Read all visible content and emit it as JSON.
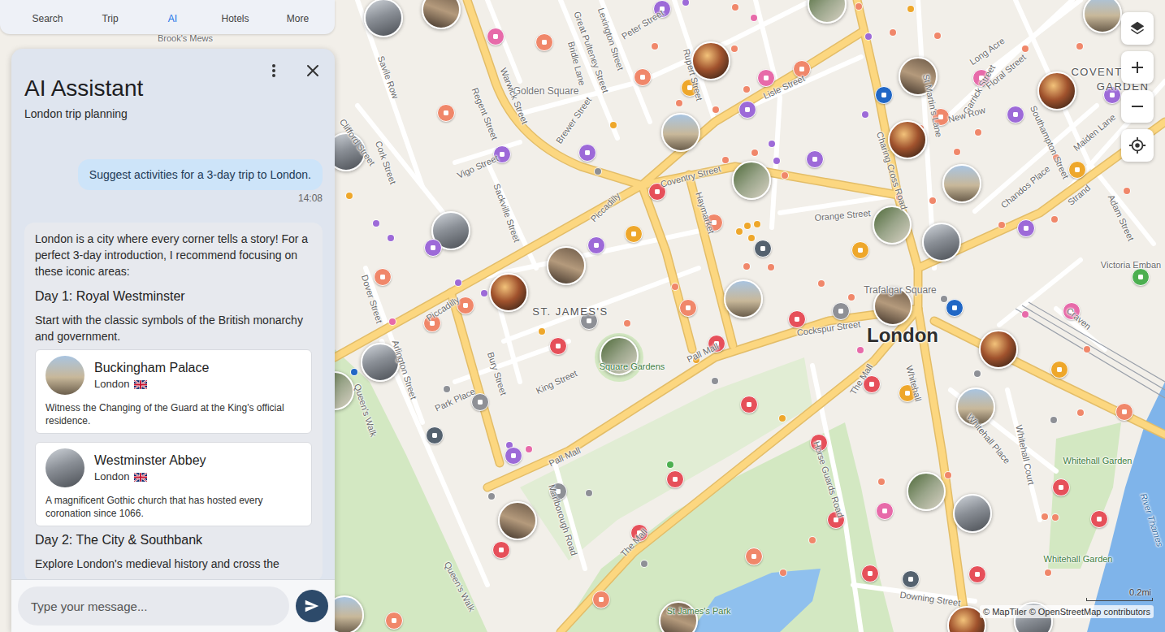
{
  "navigation": {
    "tabs": [
      {
        "label": "Search",
        "selected": false
      },
      {
        "label": "Trip",
        "selected": false
      },
      {
        "label": "AI",
        "selected": true
      },
      {
        "label": "Hotels",
        "selected": false
      },
      {
        "label": "More",
        "selected": false
      }
    ]
  },
  "assistant": {
    "title": "AI Assistant",
    "subtitle": "London trip planning",
    "user_message": {
      "text": "Suggest activities for a 3-day trip to London.",
      "time": "14:08"
    },
    "reply": {
      "intro": "London is a city where every corner tells a story! For a perfect 3-day introduction, I recommend focusing on these iconic areas:",
      "sections": [
        {
          "heading": "Day 1: Royal Westminster",
          "text": "Start with the classic symbols of the British monarchy and government.",
          "places": [
            {
              "name": "Buckingham Palace",
              "city": "London",
              "description": "Witness the Changing of the Guard at the King's official residence."
            },
            {
              "name": "Westminster Abbey",
              "city": "London",
              "description": "A magnificent Gothic church that has hosted every coronation since 1066."
            }
          ]
        },
        {
          "heading": "Day 2: The City & Southbank",
          "text": "Explore London's medieval history and cross the",
          "places": []
        }
      ]
    },
    "input": {
      "placeholder": "Type your message..."
    }
  },
  "map": {
    "labels": [
      {
        "text": "Savile Row",
        "kind": "street"
      },
      {
        "text": "Golden Square",
        "kind": "area"
      },
      {
        "text": "Regent Street",
        "kind": "street"
      },
      {
        "text": "Warwick Street",
        "kind": "street"
      },
      {
        "text": "Brewer Street",
        "kind": "street"
      },
      {
        "text": "Great Pulteney Street",
        "kind": "street"
      },
      {
        "text": "Bridle Lane",
        "kind": "street"
      },
      {
        "text": "Lexington Street",
        "kind": "street"
      },
      {
        "text": "Peter Street",
        "kind": "street"
      },
      {
        "text": "Rupert Street",
        "kind": "street"
      },
      {
        "text": "Lisle Street",
        "kind": "street"
      },
      {
        "text": "Vigo Street",
        "kind": "street"
      },
      {
        "text": "Sackville Street",
        "kind": "street"
      },
      {
        "text": "Cork Street",
        "kind": "street"
      },
      {
        "text": "Clifford Street",
        "kind": "street"
      },
      {
        "text": "Piccadilly",
        "kind": "street"
      },
      {
        "text": "Piccadilly",
        "kind": "street"
      },
      {
        "text": "Coventry Street",
        "kind": "street"
      },
      {
        "text": "Haymarket",
        "kind": "street"
      },
      {
        "text": "Orange Street",
        "kind": "street"
      },
      {
        "text": "Charing Cross Road",
        "kind": "street"
      },
      {
        "text": "St Martin's Lane",
        "kind": "street"
      },
      {
        "text": "Long Acre",
        "kind": "street"
      },
      {
        "text": "Garrick Street",
        "kind": "street"
      },
      {
        "text": "Floral Street",
        "kind": "street"
      },
      {
        "text": "New Row",
        "kind": "street"
      },
      {
        "text": "Southampton Street",
        "kind": "street"
      },
      {
        "text": "Maiden Lane",
        "kind": "street"
      },
      {
        "text": "Chandos Place",
        "kind": "street"
      },
      {
        "text": "Strand",
        "kind": "street"
      },
      {
        "text": "Adam Street",
        "kind": "street"
      },
      {
        "text": "Trafalgar Square",
        "kind": "area"
      },
      {
        "text": "London",
        "kind": "city"
      },
      {
        "text": "Cockspur Street",
        "kind": "street"
      },
      {
        "text": "Craven",
        "kind": "street"
      },
      {
        "text": "Victoria Emban",
        "kind": "street"
      },
      {
        "text": "Whitehall",
        "kind": "street"
      },
      {
        "text": "Whitehall Place",
        "kind": "street"
      },
      {
        "text": "Whitehall Court",
        "kind": "street"
      },
      {
        "text": "Whitehall Garden",
        "kind": "park"
      },
      {
        "text": "Whitehall Garden",
        "kind": "park"
      },
      {
        "text": "River Thames",
        "kind": "water"
      },
      {
        "text": "Horse Guards Road",
        "kind": "street"
      },
      {
        "text": "The Mall",
        "kind": "street"
      },
      {
        "text": "The Mall",
        "kind": "street"
      },
      {
        "text": "Pall Mall",
        "kind": "street"
      },
      {
        "text": "Pall Mall",
        "kind": "street"
      },
      {
        "text": "ST. JAMES'S",
        "kind": "district"
      },
      {
        "text": "King Street",
        "kind": "street"
      },
      {
        "text": "Bury Street",
        "kind": "street"
      },
      {
        "text": "Park Place",
        "kind": "street"
      },
      {
        "text": "Arlington Street",
        "kind": "street"
      },
      {
        "text": "Dover Street",
        "kind": "street"
      },
      {
        "text": "Queen's Walk",
        "kind": "street"
      },
      {
        "text": "Queen's Walk",
        "kind": "street"
      },
      {
        "text": "Marlborough Road",
        "kind": "street"
      },
      {
        "text": "Downing Street",
        "kind": "street"
      },
      {
        "text": "St James's Park",
        "kind": "park"
      },
      {
        "text": "Square Gardens",
        "kind": "park"
      },
      {
        "text": "Brook's Mews",
        "kind": "street"
      },
      {
        "text": "COVENT",
        "kind": "district"
      },
      {
        "text": "GARDEN",
        "kind": "district"
      }
    ],
    "markers": [
      {
        "kind": "photo"
      },
      {
        "kind": "photo"
      },
      {
        "kind": "photo"
      },
      {
        "kind": "photo"
      },
      {
        "kind": "photo"
      },
      {
        "kind": "photo"
      },
      {
        "kind": "photo"
      },
      {
        "kind": "photo"
      },
      {
        "kind": "photo"
      },
      {
        "kind": "photo"
      },
      {
        "kind": "photo"
      },
      {
        "kind": "photo"
      },
      {
        "kind": "photo"
      },
      {
        "kind": "photo"
      },
      {
        "kind": "photo"
      },
      {
        "kind": "photo"
      },
      {
        "kind": "photo"
      },
      {
        "kind": "photo"
      },
      {
        "kind": "photo"
      },
      {
        "kind": "photo"
      },
      {
        "kind": "photo"
      },
      {
        "kind": "photo"
      },
      {
        "kind": "photo"
      },
      {
        "kind": "photo"
      },
      {
        "kind": "photo"
      },
      {
        "kind": "photo"
      },
      {
        "kind": "photo"
      },
      {
        "kind": "photo"
      },
      {
        "kind": "photo"
      },
      {
        "kind": "photo"
      },
      {
        "kind": "photo"
      },
      {
        "kind": "poi",
        "color": "#9d6ad8"
      },
      {
        "kind": "poi",
        "color": "#e76aa9"
      },
      {
        "kind": "poi",
        "color": "#f0876a"
      },
      {
        "kind": "poi",
        "color": "#f0876a"
      },
      {
        "kind": "poi",
        "color": "#eea72b"
      },
      {
        "kind": "poi",
        "color": "#e76aa9"
      },
      {
        "kind": "poi",
        "color": "#f0876a"
      },
      {
        "kind": "poi",
        "color": "#9d6ad8"
      },
      {
        "kind": "poi",
        "color": "#f0876a"
      },
      {
        "kind": "poi",
        "color": "#9d6ad8"
      },
      {
        "kind": "poi",
        "color": "#9d6ad8"
      },
      {
        "kind": "poi",
        "color": "#9d6ad8"
      },
      {
        "kind": "poi",
        "color": "#2167c5"
      },
      {
        "kind": "poi",
        "color": "#e76aa9"
      },
      {
        "kind": "poi",
        "color": "#f0876a"
      },
      {
        "kind": "poi",
        "color": "#9d6ad8"
      },
      {
        "kind": "poi",
        "color": "#9d6ad8"
      },
      {
        "kind": "poi",
        "color": "#eea72b"
      },
      {
        "kind": "poi",
        "color": "#e6505a"
      },
      {
        "kind": "poi",
        "color": "#f0876a"
      },
      {
        "kind": "poi",
        "color": "#eea72b"
      },
      {
        "kind": "poi",
        "color": "#55626f"
      },
      {
        "kind": "poi",
        "color": "#9d6ad8"
      },
      {
        "kind": "poi",
        "color": "#9d6ad8"
      },
      {
        "kind": "poi",
        "color": "#eea72b"
      },
      {
        "kind": "poi",
        "color": "#9d6ad8"
      },
      {
        "kind": "poi",
        "color": "#f0876a"
      },
      {
        "kind": "poi",
        "color": "#f0876a"
      },
      {
        "kind": "poi",
        "color": "#f0876a"
      },
      {
        "kind": "poi",
        "color": "#f0876a"
      },
      {
        "kind": "poi",
        "color": "#8e9096"
      },
      {
        "kind": "poi",
        "color": "#e6505a"
      },
      {
        "kind": "poi",
        "color": "#8e9096"
      },
      {
        "kind": "poi",
        "color": "#e6505a"
      },
      {
        "kind": "poi",
        "color": "#e6505a"
      },
      {
        "kind": "poi",
        "color": "#2167c5"
      },
      {
        "kind": "poi",
        "color": "#e76aa9"
      },
      {
        "kind": "poi",
        "color": "#4caf50"
      },
      {
        "kind": "poi",
        "color": "#8e9096"
      },
      {
        "kind": "poi",
        "color": "#55626f"
      },
      {
        "kind": "poi",
        "color": "#e6505a"
      },
      {
        "kind": "poi",
        "color": "#eea72b"
      },
      {
        "kind": "poi",
        "color": "#eea72b"
      },
      {
        "kind": "poi",
        "color": "#e6505a"
      },
      {
        "kind": "poi",
        "color": "#e6505a"
      },
      {
        "kind": "poi",
        "color": "#f0876a"
      },
      {
        "kind": "poi",
        "color": "#9d6ad8"
      },
      {
        "kind": "poi",
        "color": "#e6505a"
      },
      {
        "kind": "poi",
        "color": "#e76aa9"
      },
      {
        "kind": "poi",
        "color": "#e6505a"
      },
      {
        "kind": "poi",
        "color": "#e6505a"
      },
      {
        "kind": "poi",
        "color": "#e6505a"
      },
      {
        "kind": "poi",
        "color": "#8e9096"
      },
      {
        "kind": "poi",
        "color": "#e6505a"
      },
      {
        "kind": "poi",
        "color": "#e6505a"
      },
      {
        "kind": "poi",
        "color": "#f0876a"
      },
      {
        "kind": "poi",
        "color": "#e6505a"
      },
      {
        "kind": "poi",
        "color": "#55626f"
      },
      {
        "kind": "poi",
        "color": "#e6505a"
      },
      {
        "kind": "poi",
        "color": "#f0876a"
      },
      {
        "kind": "poi",
        "color": "#f0876a"
      }
    ],
    "dots": [
      {
        "color": "#f0876a"
      },
      {
        "color": "#e76aa9"
      },
      {
        "color": "#f0876a"
      },
      {
        "color": "#eea72b"
      },
      {
        "color": "#f0876a"
      },
      {
        "color": "#f0876a"
      },
      {
        "color": "#f0876a"
      },
      {
        "color": "#9d6ad8"
      },
      {
        "color": "#f0876a"
      },
      {
        "color": "#9d6ad8"
      },
      {
        "color": "#f0876a"
      },
      {
        "color": "#f0876a"
      },
      {
        "color": "#f0876a"
      },
      {
        "color": "#f0876a"
      },
      {
        "color": "#9d6ad8"
      },
      {
        "color": "#9d6ad8"
      },
      {
        "color": "#f0876a"
      },
      {
        "color": "#f0876a"
      },
      {
        "color": "#f0876a"
      },
      {
        "color": "#f0876a"
      },
      {
        "color": "#eea72b"
      },
      {
        "color": "#8e9096"
      },
      {
        "color": "#eea72b"
      },
      {
        "color": "#9d6ad8"
      },
      {
        "color": "#9d6ad8"
      },
      {
        "color": "#9d6ad8"
      },
      {
        "color": "#9d6ad8"
      },
      {
        "color": "#2167c5"
      },
      {
        "color": "#e76aa9"
      },
      {
        "color": "#8e9096"
      },
      {
        "color": "#eea72b"
      },
      {
        "color": "#f0876a"
      },
      {
        "color": "#f0876a"
      },
      {
        "color": "#eea72b"
      },
      {
        "color": "#8e9096"
      },
      {
        "color": "#f0876a"
      },
      {
        "color": "#f0876a"
      },
      {
        "color": "#eea72b"
      },
      {
        "color": "#eea72b"
      },
      {
        "color": "#eea72b"
      },
      {
        "color": "#eea72b"
      },
      {
        "color": "#f0876a"
      },
      {
        "color": "#f0876a"
      },
      {
        "color": "#e76aa9"
      },
      {
        "color": "#8e9096"
      },
      {
        "color": "#8e9096"
      },
      {
        "color": "#f0876a"
      },
      {
        "color": "#f0876a"
      },
      {
        "color": "#8e9096"
      },
      {
        "color": "#f0876a"
      },
      {
        "color": "#e76aa9"
      },
      {
        "color": "#f0876a"
      },
      {
        "color": "#f0876a"
      },
      {
        "color": "#f0876a"
      },
      {
        "color": "#f0876a"
      },
      {
        "color": "#f0876a"
      },
      {
        "color": "#f0876a"
      },
      {
        "color": "#f0876a"
      },
      {
        "color": "#eea72b"
      },
      {
        "color": "#8e9096"
      },
      {
        "color": "#8e9096"
      },
      {
        "color": "#8e9096"
      },
      {
        "color": "#e76aa9"
      },
      {
        "color": "#9d6ad8"
      },
      {
        "color": "#f0876a"
      },
      {
        "color": "#f0876a"
      },
      {
        "color": "#f0876a"
      },
      {
        "color": "#f0876a"
      },
      {
        "color": "#f0876a"
      },
      {
        "color": "#f0876a"
      },
      {
        "color": "#f0876a"
      },
      {
        "color": "#f0876a"
      },
      {
        "color": "#9d6ad8"
      },
      {
        "color": "#f0876a"
      },
      {
        "color": "#4caf50"
      }
    ],
    "scale": "0.2mi",
    "attribution": "© MapTiler © OpenStreetMap contributors"
  }
}
